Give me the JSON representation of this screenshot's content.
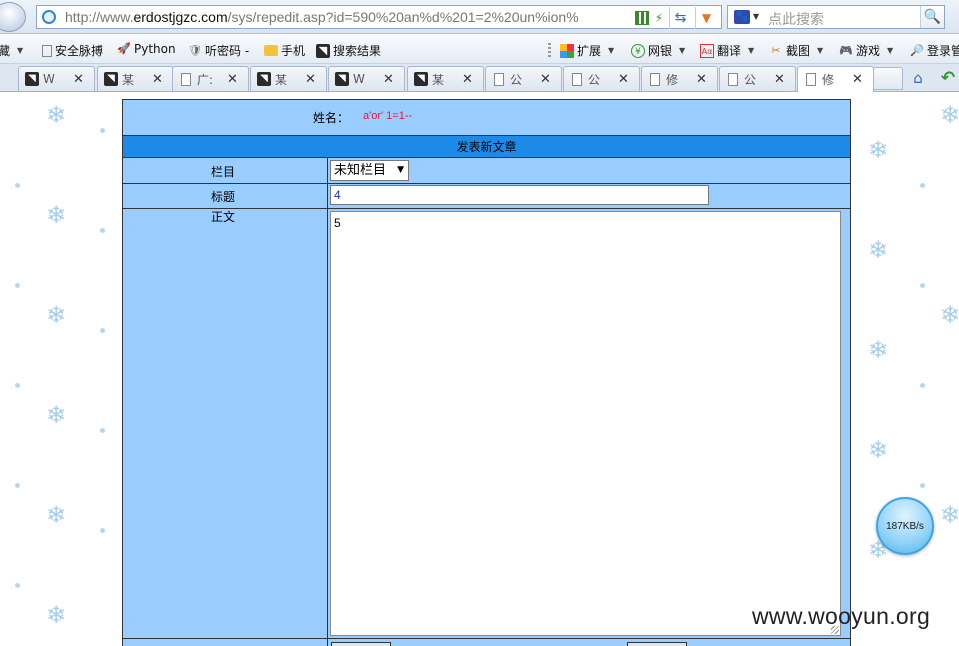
{
  "address_bar": {
    "url_prefix": "http://www.",
    "url_host": "erdostjgzc.com",
    "url_path": "/sys/repedit.asp?id=590%20an%d%201=2%20un%ion%",
    "search_placeholder": "点此搜索"
  },
  "bookmarks": [
    {
      "label": "藏",
      "icon": "collapsed-bookmark"
    },
    {
      "label": "安全脉搏",
      "icon": "page-icon"
    },
    {
      "label": "Python",
      "icon": "rocket-icon"
    },
    {
      "label": "听密码 -",
      "icon": "shield-icon"
    },
    {
      "label": "手机",
      "icon": "folder-icon"
    },
    {
      "label": "搜索结果",
      "icon": "bird-icon"
    },
    {
      "label": "扩展",
      "icon": "grid-icon"
    },
    {
      "label": "网银",
      "icon": "yen-icon"
    },
    {
      "label": "翻译",
      "icon": "translate-icon"
    },
    {
      "label": "截图",
      "icon": "scissors-icon"
    },
    {
      "label": "游戏",
      "icon": "gamepad-icon"
    },
    {
      "label": "登录管",
      "icon": "search-icon"
    }
  ],
  "tabs": [
    {
      "label": "W",
      "icon": "bird"
    },
    {
      "label": "某",
      "icon": "bird"
    },
    {
      "label": "广:",
      "icon": "page"
    },
    {
      "label": "某",
      "icon": "bird"
    },
    {
      "label": "W",
      "icon": "bird"
    },
    {
      "label": "某",
      "icon": "bird"
    },
    {
      "label": "公",
      "icon": "page"
    },
    {
      "label": "公",
      "icon": "page"
    },
    {
      "label": "修",
      "icon": "page"
    },
    {
      "label": "公",
      "icon": "page"
    },
    {
      "label": "修",
      "icon": "page",
      "active": true
    }
  ],
  "form": {
    "name_label": "姓名：",
    "name_value": "a'or' 1=1--",
    "section_title": "发表新文章",
    "category_label": "栏目",
    "category_selected": "未知栏目",
    "title_label": "标题",
    "title_value": "4",
    "body_label": "正文",
    "body_value": "5"
  },
  "speed_indicator": "187KB/s",
  "watermark": "www.wooyun.org",
  "colors": {
    "form_background": "#99ccff",
    "section_bar": "#1e8ae8",
    "name_value": "#e8183a",
    "title_value": "#1d33b8"
  }
}
